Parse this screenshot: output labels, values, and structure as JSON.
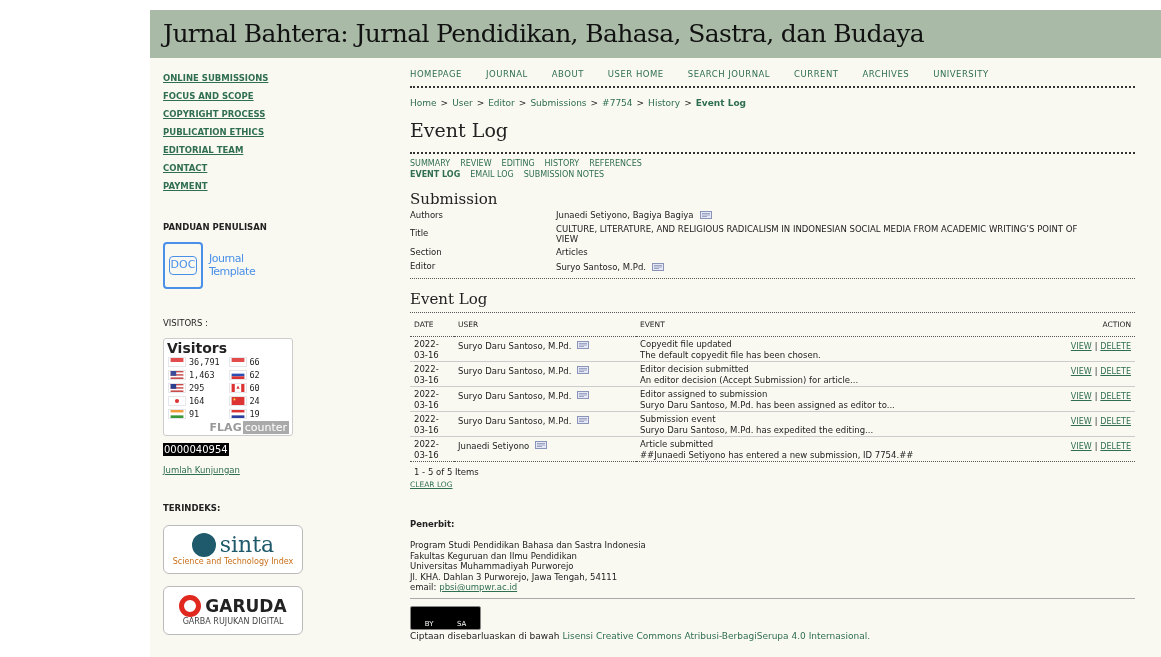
{
  "header": {
    "title": "Jurnal Bahtera: Jurnal Pendidikan, Bahasa, Sastra, dan Budaya"
  },
  "sidebar": {
    "links": [
      "ONLINE SUBMISSIONS",
      "FOCUS AND SCOPE",
      "COPYRIGHT PROCESS",
      "PUBLICATION ETHICS",
      "EDITORIAL TEAM",
      "CONTACT",
      "PAYMENT"
    ],
    "guide": {
      "heading": "PANDUAN PENULISAN",
      "doc_label": "DOC",
      "template_line1": "Journal",
      "template_line2": "Template"
    },
    "visitors": {
      "heading": "VISITORS :",
      "widget_title": "Visitors",
      "countries": [
        {
          "kind": "indonesia",
          "count": "36,791"
        },
        {
          "kind": "singapore",
          "count": "66"
        },
        {
          "kind": "usa",
          "count": "1,463"
        },
        {
          "kind": "russia",
          "count": "62"
        },
        {
          "kind": "malaysia",
          "count": "295"
        },
        {
          "kind": "canada",
          "count": "60"
        },
        {
          "kind": "japan",
          "count": "164"
        },
        {
          "kind": "china",
          "count": "24"
        },
        {
          "kind": "india",
          "count": "91"
        },
        {
          "kind": "netherlands",
          "count": "19"
        }
      ],
      "brand_bold": "FLAG",
      "brand_light": "counter",
      "counter": "0000040954",
      "link": "Jumlah Kunjungan"
    },
    "indexed": {
      "heading": "TERINDEKS:",
      "sinta_name": "sinta",
      "sinta_tagline": "Science and Technology Index",
      "garuda_name": "GARUDA",
      "garuda_tagline": "GARBA RUJUKAN DIGITAL"
    }
  },
  "nav": [
    "HOMEPAGE",
    "JOURNAL",
    "ABOUT",
    "USER HOME",
    "SEARCH JOURNAL",
    "CURRENT",
    "ARCHIVES",
    "UNIVERSITY"
  ],
  "breadcrumb": [
    {
      "label": "Home",
      "selected": false
    },
    {
      "separator": ">",
      "label": "User",
      "selected": false
    },
    {
      "separator": ">",
      "label": "Editor",
      "selected": false
    },
    {
      "separator": ">",
      "label": "Submissions",
      "selected": false
    },
    {
      "separator": ">",
      "label": "#7754",
      "selected": false
    },
    {
      "separator": ">",
      "label": "History",
      "selected": false
    },
    {
      "separator": ">",
      "label": "Event Log",
      "selected": true
    }
  ],
  "page_title": "Event Log",
  "subtabs": [
    [
      {
        "label": "SUMMARY",
        "selected": false
      },
      {
        "label": "REVIEW",
        "selected": false
      },
      {
        "label": "EDITING",
        "selected": false
      },
      {
        "label": "HISTORY",
        "selected": false
      },
      {
        "label": "REFERENCES",
        "selected": false
      }
    ],
    [
      {
        "label": "EVENT LOG",
        "selected": true
      },
      {
        "label": "EMAIL LOG",
        "selected": false
      },
      {
        "label": "SUBMISSION NOTES",
        "selected": false
      }
    ]
  ],
  "submission": {
    "heading": "Submission",
    "fields": [
      {
        "label": "Authors",
        "value": "Junaedi Setiyono, Bagiya Bagiya",
        "mail": true
      },
      {
        "label": "Title",
        "value": "CULTURE, LITERATURE, AND RELIGIOUS RADICALISM IN INDONESIAN SOCIAL MEDIA FROM ACADEMIC WRITING’S POINT OF VIEW",
        "mail": false
      },
      {
        "label": "Section",
        "value": "Articles",
        "mail": false
      },
      {
        "label": "Editor",
        "value": "Suryo Santoso, M.Pd.",
        "mail": true
      }
    ]
  },
  "event_log": {
    "heading": "Event Log",
    "columns": [
      "DATE",
      "USER",
      "EVENT",
      "ACTION"
    ],
    "rows": [
      {
        "date": "2022-03-16",
        "user": "Suryo Daru Santoso, M.Pd.",
        "event": "Copyedit file updated",
        "detail": "The default copyedit file has been chosen.",
        "view": "VIEW",
        "sep": "|",
        "delete": "DELETE"
      },
      {
        "date": "2022-03-16",
        "user": "Suryo Daru Santoso, M.Pd.",
        "event": "Editor decision submitted",
        "detail": "An editor decision (Accept Submission) for article...",
        "view": "VIEW",
        "sep": "|",
        "delete": "DELETE"
      },
      {
        "date": "2022-03-16",
        "user": "Suryo Daru Santoso, M.Pd.",
        "event": "Editor assigned to submission",
        "detail": "Suryo Daru Santoso, M.Pd. has been assigned as editor to...",
        "view": "VIEW",
        "sep": "|",
        "delete": "DELETE"
      },
      {
        "date": "2022-03-16",
        "user": "Suryo Daru Santoso, M.Pd.",
        "event": "Submission event",
        "detail": "Suryo Daru Santoso, M.Pd. has expedited the editing...",
        "view": "VIEW",
        "sep": "|",
        "delete": "DELETE"
      },
      {
        "date": "2022-03-16",
        "user": "Junaedi Setiyono",
        "event": "Article submitted",
        "detail": "##Junaedi Setiyono has entered a new submission, ID 7754.##",
        "view": "VIEW",
        "sep": "|",
        "delete": "DELETE"
      }
    ],
    "count": "1 - 5 of 5 Items",
    "clear": "CLEAR LOG"
  },
  "footer": {
    "heading": "Penerbit:",
    "lines": [
      "Program Studi Pendidikan Bahasa dan Sastra Indonesia",
      "Fakultas Keguruan dan Ilmu Pendidikan",
      "Universitas Muhammadiyah Purworejo",
      "Jl. KHA. Dahlan 3 Purworejo, Jawa Tengah, 54111"
    ],
    "email_label": "email:",
    "email": "pbsi@umpwr.ac.id",
    "cc_by": "BY",
    "cc_sa": "SA",
    "license_text": "Ciptaan disebarluaskan di bawah",
    "license_link": "Lisensi Creative Commons Atribusi-BerbagiSerupa 4.0 Internasional."
  }
}
